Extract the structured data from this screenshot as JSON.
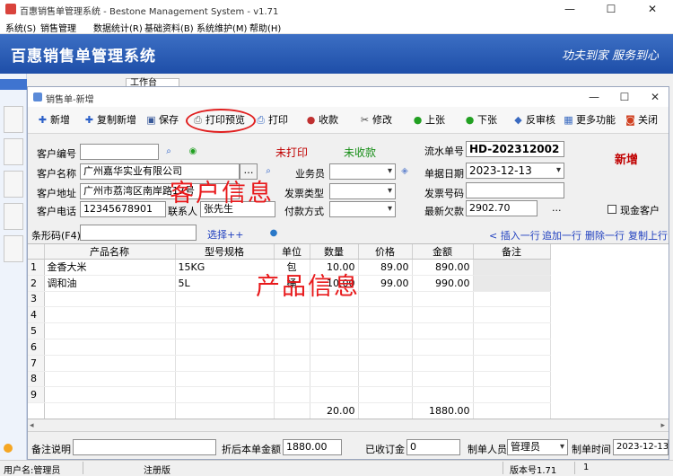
{
  "app": {
    "title": "百惠销售单管理系统 - Bestone Management System - v1.71",
    "menu": [
      "系统(S)",
      "销售管理",
      "数据统计(R)",
      "基础资料(B)",
      "系统维护(M)",
      "帮助(H)"
    ],
    "banner_title": "百惠销售单管理系统",
    "slogan": "功夫到家  服务到心",
    "bg_tab": "工作台",
    "window_buttons": [
      "—",
      "☐",
      "✕"
    ]
  },
  "status": {
    "user": "用户名:管理员",
    "edition": "注册版",
    "version": "版本号1.71",
    "page": "1"
  },
  "child": {
    "title": "销售单-新增",
    "window_buttons": [
      "—",
      "☐",
      "✕"
    ],
    "toolbar": [
      {
        "label": "新增",
        "icon": "plus-icon",
        "glyph": "✚",
        "color": "#2a5fc8"
      },
      {
        "label": "复制新增",
        "icon": "copy-add-icon",
        "glyph": "✚",
        "color": "#2a5fc8"
      },
      {
        "label": "保存",
        "icon": "save-icon",
        "glyph": "▣",
        "color": "#3a5a9a"
      },
      {
        "label": "打印预览",
        "icon": "print-preview-icon",
        "glyph": "⎙",
        "color": "#666666"
      },
      {
        "label": "打印",
        "icon": "print-icon",
        "glyph": "⎙",
        "color": "#3a6ac0"
      },
      {
        "label": "收款",
        "icon": "receive-icon",
        "glyph": "●",
        "color": "#c03030"
      },
      {
        "label": "修改",
        "icon": "edit-icon",
        "glyph": "✂",
        "color": "#444444"
      },
      {
        "label": "上张",
        "icon": "prev-icon",
        "glyph": "●",
        "color": "#22a022"
      },
      {
        "label": "下张",
        "icon": "next-icon",
        "glyph": "●",
        "color": "#22a022"
      },
      {
        "label": "反审核",
        "icon": "unaudit-icon",
        "glyph": "◆",
        "color": "#3a6ac0"
      },
      {
        "label": "更多功能",
        "icon": "more-icon",
        "glyph": "▦",
        "color": "#3a6ac0"
      },
      {
        "label": "关闭",
        "icon": "close-icon",
        "glyph": "◙",
        "color": "#d04020"
      }
    ]
  },
  "form": {
    "customer_code_label": "客户编号",
    "customer_code": "",
    "print_status": "未打印",
    "receipt_status": "未收款",
    "serial_label": "流水单号",
    "serial": "HD-202312002",
    "customer_name_label": "客户名称",
    "customer_name": "广州嘉华实业有限公司",
    "salesman_label": "业务员",
    "salesman": "",
    "date_label": "单据日期",
    "date": "2023-12-13",
    "mode": "新增",
    "address_label": "客户地址",
    "address": "广州市荔湾区南岸路17号",
    "invoice_type_label": "发票类型",
    "invoice_type": "",
    "invoice_no_label": "发票号码",
    "invoice_no": "",
    "phone_label": "客户电话",
    "phone": "12345678901",
    "contact_label": "联系人",
    "contact": "张先生",
    "payment_label": "付款方式",
    "payment": "",
    "arrears_label": "最新欠款",
    "arrears": "2902.70",
    "ellipsis": "...",
    "cash_label": "现金客户",
    "barcode_label": "条形码(F4)",
    "barcode": "",
    "select_label": "选择++",
    "grid_actions": [
      "< 插入一行",
      "追加一行",
      "删除一行",
      "复制上行"
    ],
    "overlay_customer": "客户信息",
    "overlay_product": "产品信息"
  },
  "grid": {
    "columns": [
      "",
      "产品名称",
      "型号规格",
      "单位",
      "数量",
      "价格",
      "金额",
      "备注"
    ],
    "rows": [
      {
        "no": "1",
        "name": "金香大米",
        "spec": "15KG",
        "unit": "包",
        "qty": "10.00",
        "price": "89.00",
        "amount": "890.00",
        "remark": ""
      },
      {
        "no": "2",
        "name": "调和油",
        "spec": "5L",
        "unit": "桶",
        "qty": "10.00",
        "price": "99.00",
        "amount": "990.00",
        "remark": ""
      },
      {
        "no": "3",
        "name": "",
        "spec": "",
        "unit": "",
        "qty": "",
        "price": "",
        "amount": "",
        "remark": ""
      },
      {
        "no": "4",
        "name": "",
        "spec": "",
        "unit": "",
        "qty": "",
        "price": "",
        "amount": "",
        "remark": ""
      },
      {
        "no": "5",
        "name": "",
        "spec": "",
        "unit": "",
        "qty": "",
        "price": "",
        "amount": "",
        "remark": ""
      },
      {
        "no": "6",
        "name": "",
        "spec": "",
        "unit": "",
        "qty": "",
        "price": "",
        "amount": "",
        "remark": ""
      },
      {
        "no": "7",
        "name": "",
        "spec": "",
        "unit": "",
        "qty": "",
        "price": "",
        "amount": "",
        "remark": ""
      },
      {
        "no": "8",
        "name": "",
        "spec": "",
        "unit": "",
        "qty": "",
        "price": "",
        "amount": "",
        "remark": ""
      },
      {
        "no": "9",
        "name": "",
        "spec": "",
        "unit": "",
        "qty": "",
        "price": "",
        "amount": "",
        "remark": ""
      }
    ],
    "total_qty": "20.00",
    "total_amount": "1880.00"
  },
  "footer": {
    "remark_label": "备注说明",
    "remark": "",
    "discount_label": "折后本单金额",
    "discount_amount": "1880.00",
    "deposit_label": "已收订金",
    "deposit": "0",
    "maker_label": "制单人员",
    "maker": "管理员",
    "make_time_label": "制单时间",
    "make_time": "2023-12-13"
  }
}
